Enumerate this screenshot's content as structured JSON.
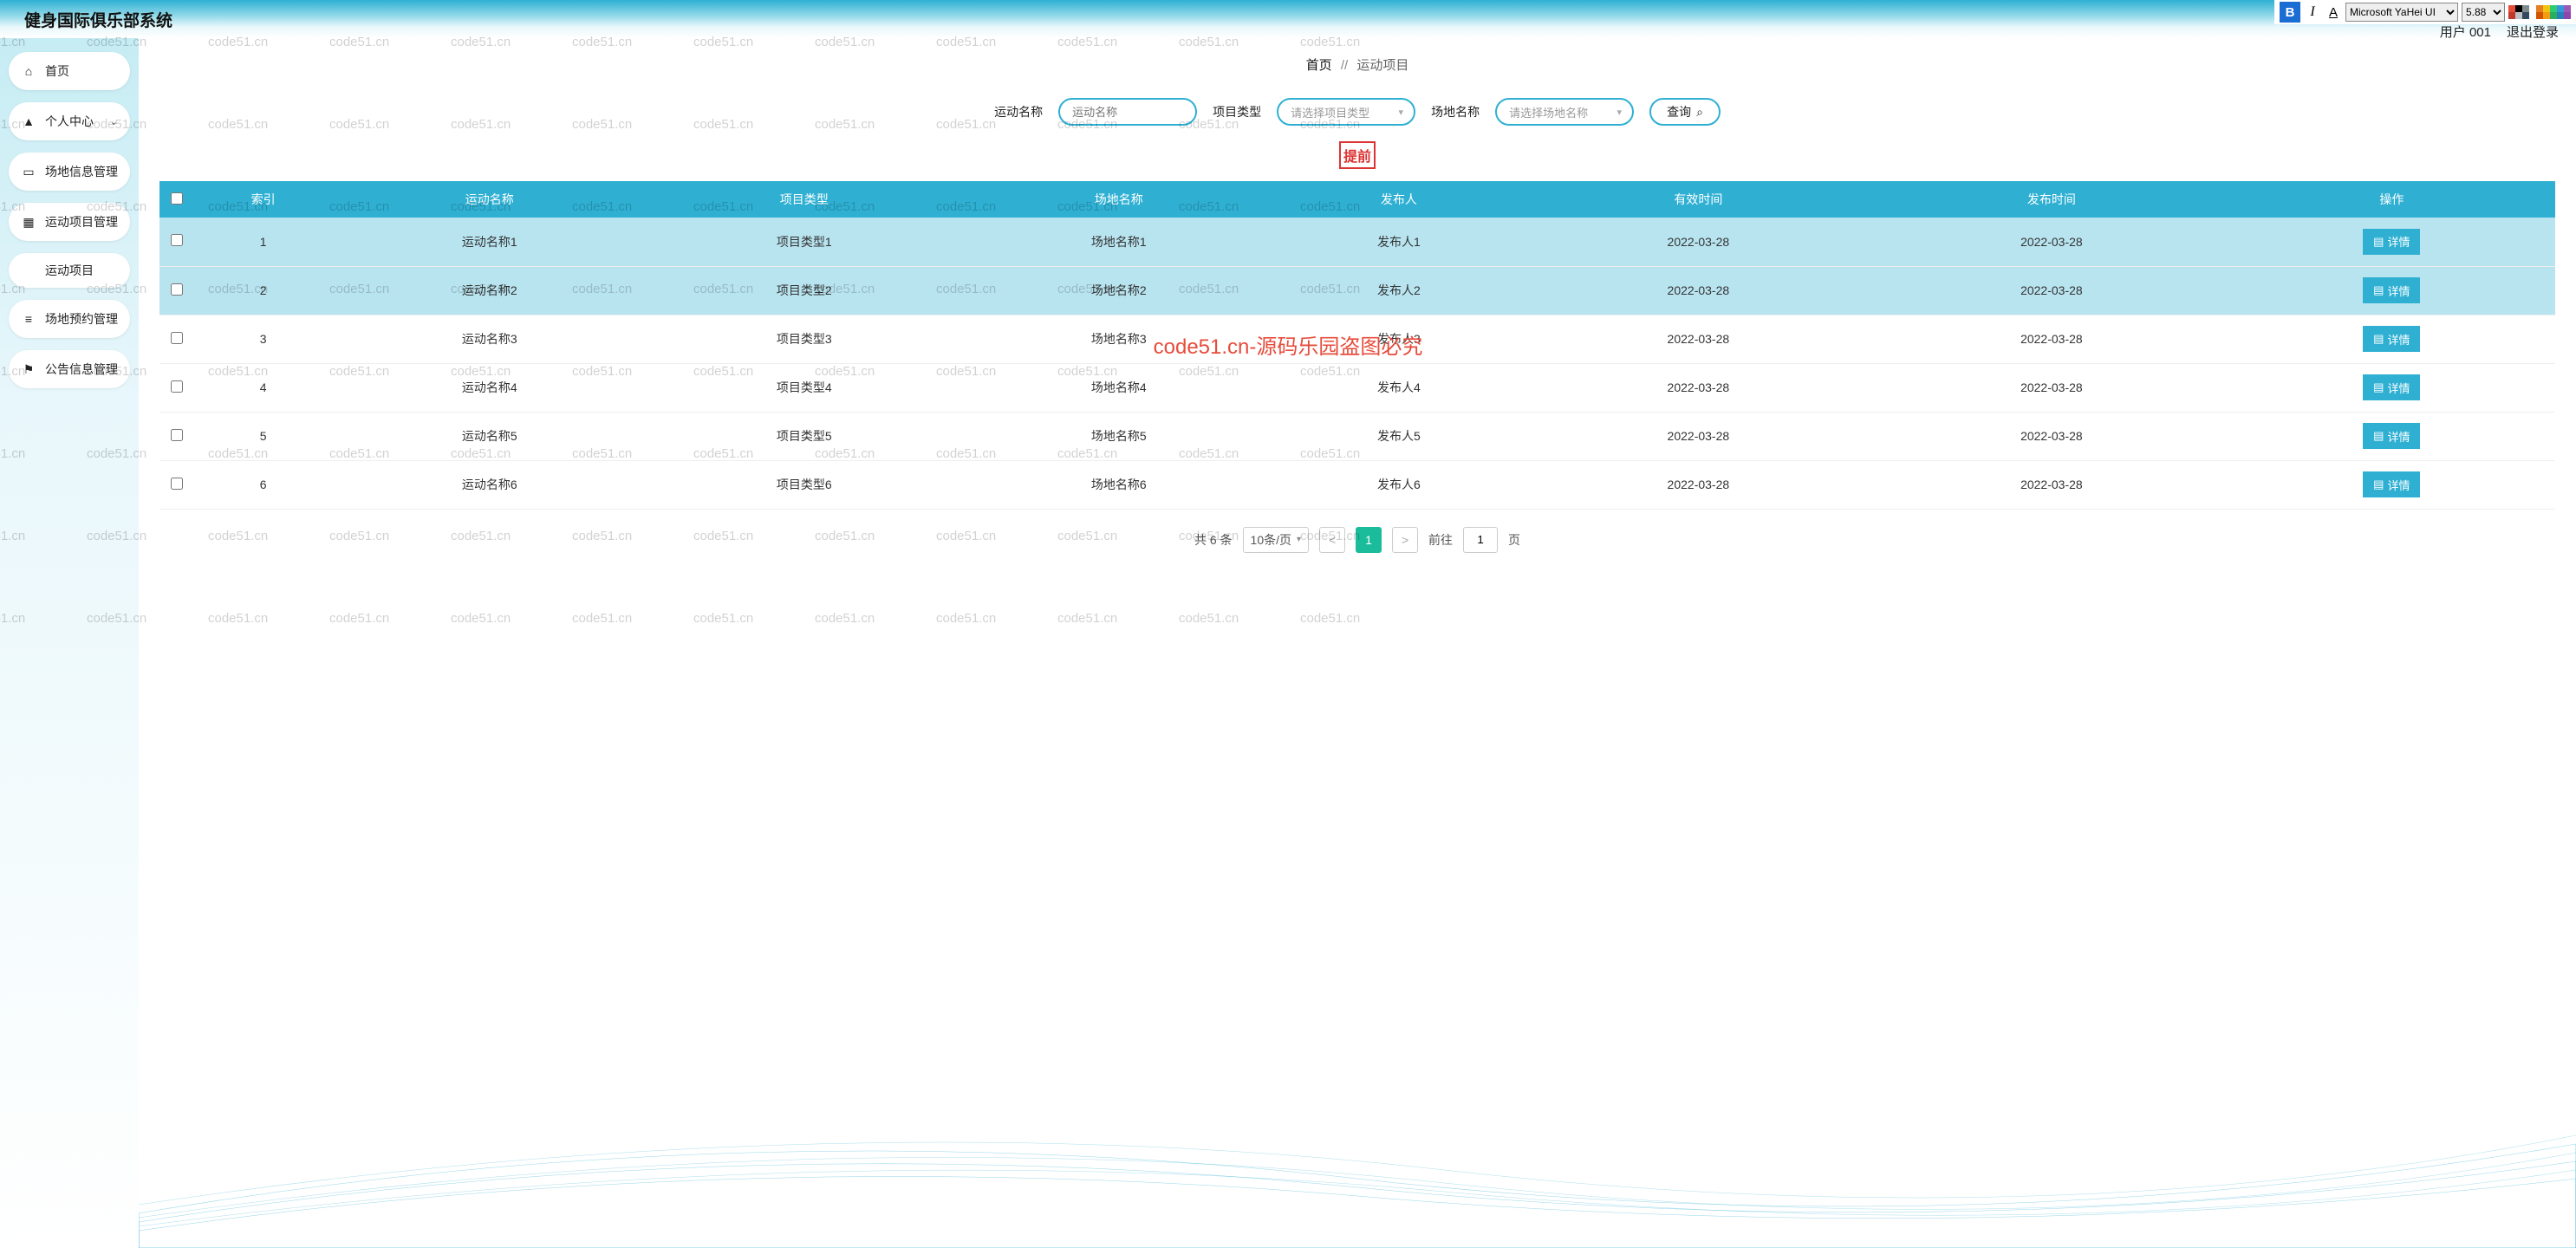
{
  "editor": {
    "bold": "B",
    "italic": "I",
    "underline": "A",
    "font": "Microsoft YaHei UI",
    "size": "5.88",
    "swatch_colors": [
      "#e74c3c",
      "#000",
      "#7f8c8d",
      "#fff",
      "#e67e22",
      "#f1c40f",
      "#2ecc71",
      "#3498db",
      "#9b59b6",
      "#c0392b",
      "#bdc3c7",
      "#34495e",
      "#fff",
      "#d35400",
      "#f39c12",
      "#27ae60",
      "#2980b9",
      "#8e44ad"
    ]
  },
  "header": {
    "title": "健身国际俱乐部系统",
    "user": "用户 001",
    "logout": "退出登录"
  },
  "sidebar": {
    "items": [
      {
        "icon": "home",
        "label": "首页",
        "expandable": false
      },
      {
        "icon": "user",
        "label": "个人中心",
        "expandable": true
      },
      {
        "icon": "monitor",
        "label": "场地信息管理",
        "expandable": true
      },
      {
        "icon": "grid",
        "label": "运动项目管理",
        "expandable": true
      },
      {
        "icon": "list",
        "label": "场地预约管理",
        "expandable": true
      },
      {
        "icon": "flag",
        "label": "公告信息管理",
        "expandable": true
      }
    ],
    "sub_item": "运动项目"
  },
  "breadcrumb": {
    "home": "首页",
    "sep": "//",
    "current": "运动项目"
  },
  "filters": {
    "f1_label": "运动名称",
    "f1_placeholder": "运动名称",
    "f2_label": "项目类型",
    "f2_placeholder": "请选择项目类型",
    "f3_label": "场地名称",
    "f3_placeholder": "请选择场地名称",
    "query": "查询"
  },
  "badge_advance": "提前",
  "table": {
    "columns": [
      "",
      "索引",
      "运动名称",
      "项目类型",
      "场地名称",
      "发布人",
      "有效时间",
      "发布时间",
      "操作"
    ],
    "detail_btn": "详情",
    "rows": [
      {
        "idx": "1",
        "name": "运动名称1",
        "type": "项目类型1",
        "venue": "场地名称1",
        "pub": "发布人1",
        "valid": "2022-03-28",
        "pubtime": "2022-03-28",
        "sel": true
      },
      {
        "idx": "2",
        "name": "运动名称2",
        "type": "项目类型2",
        "venue": "场地名称2",
        "pub": "发布人2",
        "valid": "2022-03-28",
        "pubtime": "2022-03-28",
        "sel": true
      },
      {
        "idx": "3",
        "name": "运动名称3",
        "type": "项目类型3",
        "venue": "场地名称3",
        "pub": "发布人3",
        "valid": "2022-03-28",
        "pubtime": "2022-03-28",
        "sel": false
      },
      {
        "idx": "4",
        "name": "运动名称4",
        "type": "项目类型4",
        "venue": "场地名称4",
        "pub": "发布人4",
        "valid": "2022-03-28",
        "pubtime": "2022-03-28",
        "sel": false
      },
      {
        "idx": "5",
        "name": "运动名称5",
        "type": "项目类型5",
        "venue": "场地名称5",
        "pub": "发布人5",
        "valid": "2022-03-28",
        "pubtime": "2022-03-28",
        "sel": false
      },
      {
        "idx": "6",
        "name": "运动名称6",
        "type": "项目类型6",
        "venue": "场地名称6",
        "pub": "发布人6",
        "valid": "2022-03-28",
        "pubtime": "2022-03-28",
        "sel": false
      }
    ]
  },
  "pagination": {
    "total": "共 6 条",
    "page_size": "10条/页",
    "prev": "<",
    "current": "1",
    "next": ">",
    "goto_prefix": "前往",
    "goto_value": "1",
    "goto_suffix": "页"
  },
  "watermark_text": "code51.cn",
  "watermark_big": "code51.cn-源码乐园盗图必究"
}
